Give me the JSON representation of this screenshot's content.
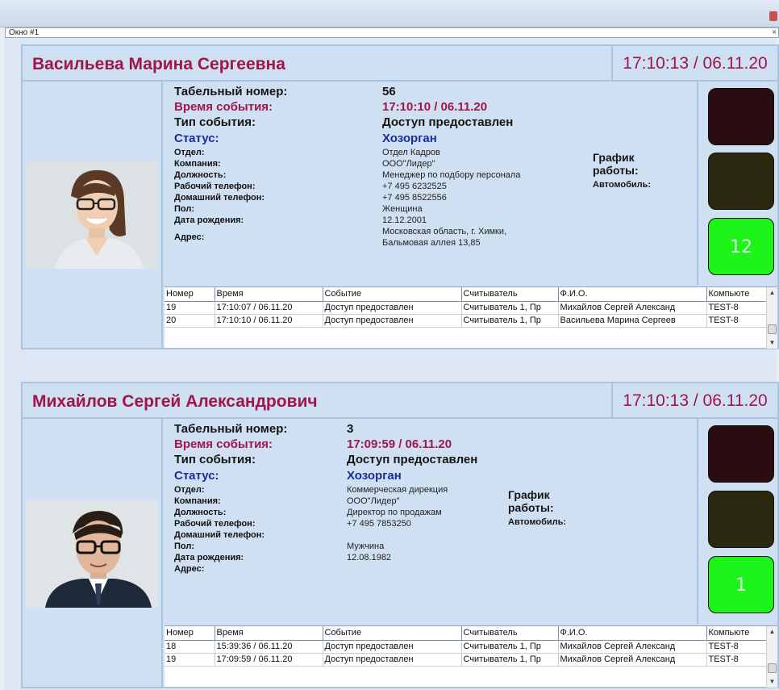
{
  "window": {
    "title": "Окно #1",
    "close_symbol": "×"
  },
  "cards": [
    {
      "name": "Васильева Марина Сергеевна",
      "clock": "17:10:13  /  06.11.20",
      "labels": {
        "tab": "Табельный номер:",
        "time": "Время события:",
        "type": "Тип события:",
        "status": "Статус:",
        "dept": "Отдел:",
        "company": "Компания:",
        "position": "Должность:",
        "work_phone": "Рабочий телефон:",
        "home_phone": "Домашний телефон:",
        "gender": "Пол:",
        "birth": "Дата рождения:",
        "address": "Адрес:"
      },
      "values": {
        "tab": "56",
        "time": "17:10:10 / 06.11.20",
        "type": "Доступ предоставлен",
        "status": "Хозорган",
        "dept": "Отдел Кадров",
        "company": "ООО\"Лидер\"",
        "position": "Менеджер по подбору персонала",
        "work_phone": "+7 495 6232525",
        "home_phone": "+7 495 8522556",
        "gender": "Женщина",
        "birth": "12.12.2001",
        "address_1": "Московская область, г. Химки,",
        "address_2": "Бальмовая аллея 13,85"
      },
      "schedule_1": "График",
      "schedule_2": "работы:",
      "auto": "Автомобиль:",
      "counter": "12",
      "table": {
        "headers": [
          "Номер",
          "Время",
          "Событие",
          "Считыватель",
          "Ф.И.О.",
          "Компьюте"
        ],
        "rows": [
          [
            "19",
            "17:10:07 / 06.11.20",
            "Доступ предоставлен",
            "Считыватель 1, Пр",
            "Михайлов Сергей Александ",
            "TEST-8"
          ],
          [
            "20",
            "17:10:10 / 06.11.20",
            "Доступ предоставлен",
            "Считыватель 1, Пр",
            "Васильева Марина Сергеев",
            "TEST-8"
          ]
        ]
      }
    },
    {
      "name": "Михайлов Сергей Александрович",
      "clock": "17:10:13  /  06.11.20",
      "labels": {
        "tab": "Табельный номер:",
        "time": "Время события:",
        "type": "Тип события:",
        "status": "Статус:",
        "dept": "Отдел:",
        "company": "Компания:",
        "position": "Должность:",
        "work_phone": "Рабочий телефон:",
        "home_phone": "Домашний телефон:",
        "gender": "Пол:",
        "birth": "Дата рождения:",
        "address": "Адрес:"
      },
      "values": {
        "tab": "3",
        "time": "17:09:59 / 06.11.20",
        "type": "Доступ предоставлен",
        "status": "Хозорган",
        "dept": "Коммерческая дирекция",
        "company": "ООО\"Лидер\"",
        "position": "Директор по продажам",
        "work_phone": "+7 495 7853250",
        "home_phone": "",
        "gender": "Мужчина",
        "birth": "12.08.1982",
        "address_1": "",
        "address_2": ""
      },
      "schedule_1": "График",
      "schedule_2": "работы:",
      "auto": "Автомобиль:",
      "counter": "1",
      "table": {
        "headers": [
          "Номер",
          "Время",
          "Событие",
          "Считыватель",
          "Ф.И.О.",
          "Компьюте"
        ],
        "rows": [
          [
            "18",
            "15:39:36 / 06.11.20",
            "Доступ предоставлен",
            "Считыватель 1, Пр",
            "Михайлов Сергей Александ",
            "TEST-8"
          ],
          [
            "19",
            "17:09:59 / 06.11.20",
            "Доступ предоставлен",
            "Считыватель 1, Пр",
            "Михайлов Сергей Александ",
            "TEST-8"
          ]
        ]
      }
    }
  ],
  "colors": {
    "name_red": "#a0154b",
    "status_blue": "#1d2b9a",
    "panel_bg": "#cfe0f3",
    "light_red_off": "#2a0c11",
    "light_yellow_off": "#2b2810",
    "light_green_on": "#1df41a"
  },
  "icons": {
    "scroll_up": "▲",
    "scroll_down": "▼"
  }
}
